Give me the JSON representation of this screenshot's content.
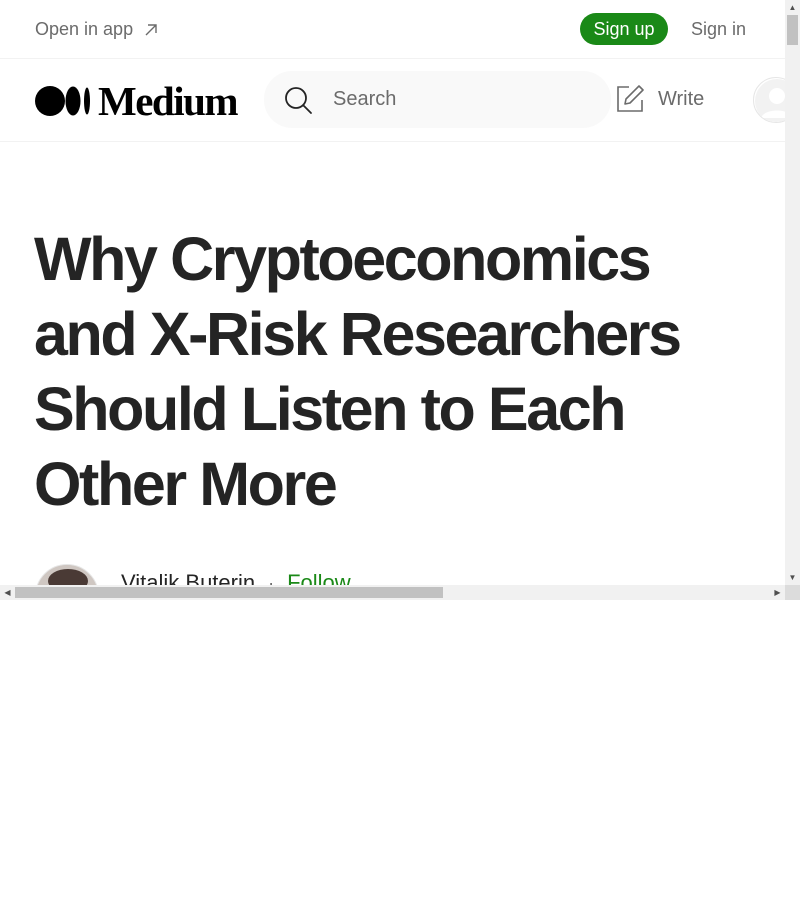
{
  "banner": {
    "open_in_app_label": "Open in app",
    "open_in_app_icon": "arrow-up-right-icon",
    "signup_label": "Sign up",
    "signin_label": "Sign in"
  },
  "header": {
    "logo_text": "Medium",
    "logo_icon": "medium-logo-mark",
    "search": {
      "placeholder": "Search",
      "value": "",
      "icon": "search-icon"
    },
    "write_label": "Write",
    "write_icon": "write-icon",
    "avatar_icon": "user-avatar-icon"
  },
  "article": {
    "title": "Why Cryptoeconomics and X-Risk Researchers Should Listen to Each Other More",
    "author": {
      "name": "Vitalik Buterin",
      "separator": "·",
      "follow_label": "Follow"
    }
  },
  "colors": {
    "accent_green": "#1a8917",
    "text_primary": "#242424",
    "text_secondary": "#6b6b6b",
    "search_bg": "#f9f9f9"
  },
  "scrollbars": {
    "vertical_icon_up": "scroll-up-arrow-icon",
    "vertical_icon_down": "scroll-down-arrow-icon",
    "horizontal_icon_left": "scroll-left-arrow-icon",
    "horizontal_icon_right": "scroll-right-arrow-icon"
  }
}
